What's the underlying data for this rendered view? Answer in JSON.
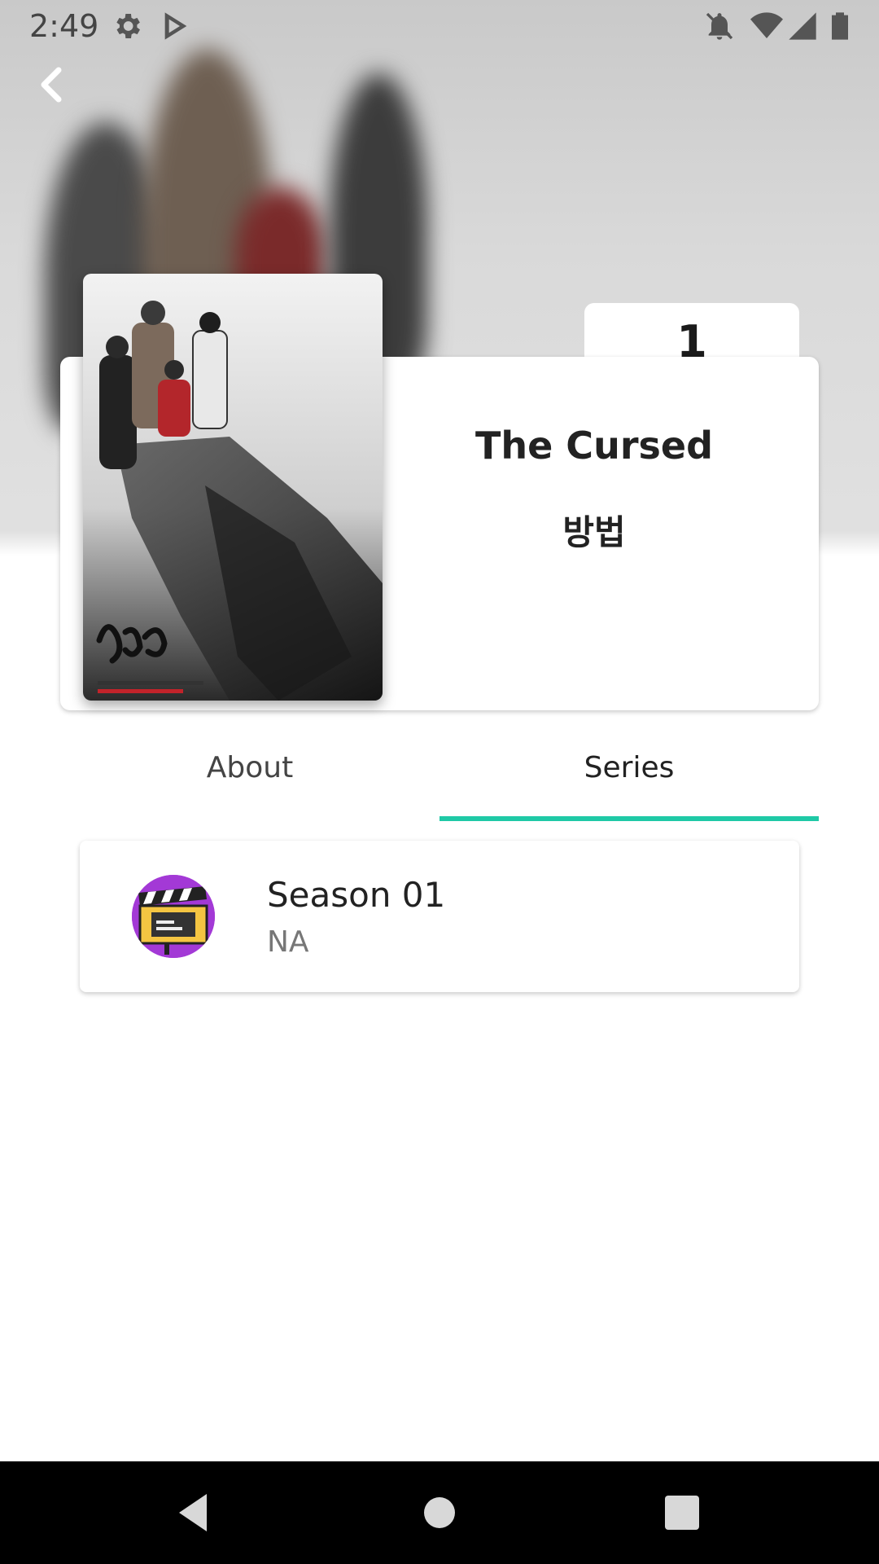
{
  "status_bar": {
    "time": "2:49",
    "icons": [
      "settings-icon",
      "play-store-icon",
      "notifications-off-icon",
      "wifi-icon",
      "signal-icon",
      "battery-icon"
    ]
  },
  "show": {
    "rank": "1",
    "title_en": "The Cursed",
    "title_ko": "방법"
  },
  "tabs": [
    {
      "label": "About",
      "selected": false
    },
    {
      "label": "Series",
      "selected": true
    }
  ],
  "seasons": [
    {
      "title": "Season 01",
      "subtitle": "NA",
      "icon": "clapperboard-icon"
    }
  ],
  "colors": {
    "accent": "#1fc9a6",
    "avatar_bg": "#a339d6"
  }
}
